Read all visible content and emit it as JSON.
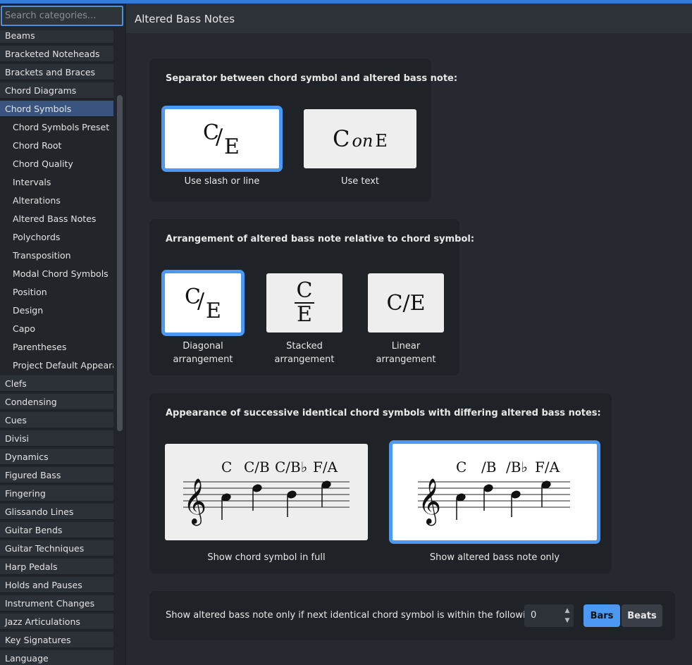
{
  "sidebar": {
    "search_placeholder": "Search categories...",
    "items": [
      {
        "label": "Beams",
        "type": "top"
      },
      {
        "label": "Bracketed Noteheads",
        "type": "top"
      },
      {
        "label": "Brackets and Braces",
        "type": "top"
      },
      {
        "label": "Chord Diagrams",
        "type": "top"
      },
      {
        "label": "Chord Symbols",
        "type": "active"
      },
      {
        "label": "Chord Symbols Preset",
        "type": "sub"
      },
      {
        "label": "Chord Root",
        "type": "sub"
      },
      {
        "label": "Chord Quality",
        "type": "sub"
      },
      {
        "label": "Intervals",
        "type": "sub"
      },
      {
        "label": "Alterations",
        "type": "sub"
      },
      {
        "label": "Altered Bass Notes",
        "type": "sub"
      },
      {
        "label": "Polychords",
        "type": "sub"
      },
      {
        "label": "Transposition",
        "type": "sub"
      },
      {
        "label": "Modal Chord Symbols",
        "type": "sub"
      },
      {
        "label": "Position",
        "type": "sub"
      },
      {
        "label": "Design",
        "type": "sub"
      },
      {
        "label": "Capo",
        "type": "sub"
      },
      {
        "label": "Parentheses",
        "type": "sub"
      },
      {
        "label": "Project Default Appearan...",
        "type": "sub"
      },
      {
        "label": "Clefs",
        "type": "top"
      },
      {
        "label": "Condensing",
        "type": "top"
      },
      {
        "label": "Cues",
        "type": "top"
      },
      {
        "label": "Divisi",
        "type": "top"
      },
      {
        "label": "Dynamics",
        "type": "top"
      },
      {
        "label": "Figured Bass",
        "type": "top"
      },
      {
        "label": "Fingering",
        "type": "top"
      },
      {
        "label": "Glissando Lines",
        "type": "top"
      },
      {
        "label": "Guitar Bends",
        "type": "top"
      },
      {
        "label": "Guitar Techniques",
        "type": "top"
      },
      {
        "label": "Harp Pedals",
        "type": "top"
      },
      {
        "label": "Holds and Pauses",
        "type": "top"
      },
      {
        "label": "Instrument Changes",
        "type": "top"
      },
      {
        "label": "Jazz Articulations",
        "type": "top"
      },
      {
        "label": "Key Signatures",
        "type": "top"
      },
      {
        "label": "Language",
        "type": "top"
      }
    ]
  },
  "page_title": "Altered Bass Notes",
  "separator": {
    "title": "Separator between chord symbol and altered bass note:",
    "slash_label": "Use slash or line",
    "text_label": "Use text",
    "slash_root": "C",
    "slash_bass": "E",
    "text_root": "C",
    "text_word": "on",
    "text_bass": "E"
  },
  "arrangement": {
    "title": "Arrangement of altered bass note relative to chord symbol:",
    "diagonal_label_1": "Diagonal",
    "diagonal_label_2": "arrangement",
    "stacked_label_1": "Stacked",
    "stacked_label_2": "arrangement",
    "linear_label_1": "Linear",
    "linear_label_2": "arrangement",
    "diag_root": "C",
    "diag_bass": "E",
    "stack_root": "C",
    "stack_bass": "E",
    "linear_text": "C/E"
  },
  "successive": {
    "title": "Appearance of successive identical chord symbols with differing altered bass notes:",
    "full_label": "Show chord symbol in full",
    "bass_only_label": "Show altered bass note only",
    "full_chords": [
      "C",
      "C/B",
      "C/B♭",
      "F/A"
    ],
    "bass_only_chords": [
      "C",
      "/B",
      "/B♭",
      "F/A"
    ]
  },
  "threshold": {
    "label": "Show altered bass note only if next identical chord symbol is within the following:",
    "value": "0",
    "bars_label": "Bars",
    "beats_label": "Beats"
  },
  "colors": {
    "accent": "#4b99f2",
    "active_item": "#39557f",
    "top_bar": "#3b79d9"
  }
}
